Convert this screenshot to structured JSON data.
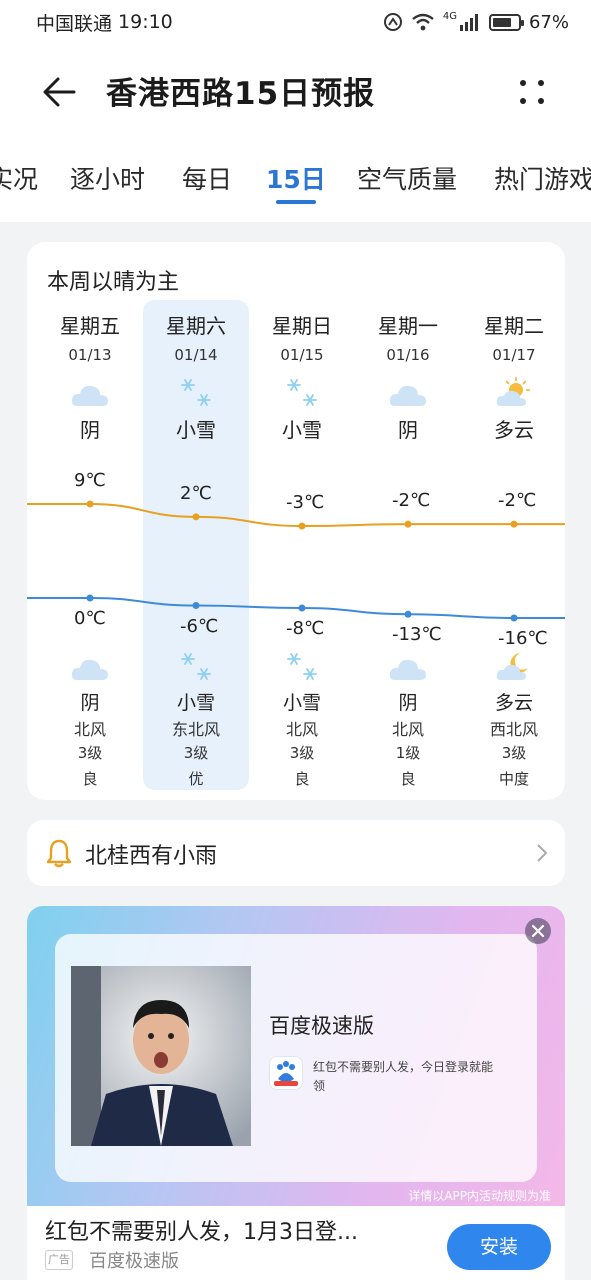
{
  "status_bar": {
    "carrier": "中国联通",
    "time": "19:10",
    "network": "4G",
    "battery": "67%"
  },
  "header": {
    "title": "香港西路15日预报",
    "back_icon": "arrow-left-icon",
    "more_icon": "more-dots-icon"
  },
  "tabs": [
    {
      "label": "实况"
    },
    {
      "label": "逐小时"
    },
    {
      "label": "每日"
    },
    {
      "label": "15日",
      "active": true
    },
    {
      "label": "空气质量"
    },
    {
      "label": "热门游戏"
    }
  ],
  "forecast": {
    "title": "本周以晴为主",
    "days": [
      {
        "day": "星期五",
        "date": "01/13",
        "day_weather": "阴",
        "day_icon": "cloud-icon",
        "high": "9℃",
        "low": "0℃",
        "night_icon": "cloud-icon",
        "night_weather": "阴",
        "wind_dir": "北风",
        "wind_level": "3级",
        "air": "良"
      },
      {
        "day": "星期六",
        "date": "01/14",
        "day_weather": "小雪",
        "day_icon": "snow-icon",
        "high": "2℃",
        "low": "-6℃",
        "night_icon": "snow-icon",
        "night_weather": "小雪",
        "wind_dir": "东北风",
        "wind_level": "3级",
        "air": "优"
      },
      {
        "day": "星期日",
        "date": "01/15",
        "day_weather": "小雪",
        "day_icon": "snow-icon",
        "high": "-3℃",
        "low": "-8℃",
        "night_icon": "snow-icon",
        "night_weather": "小雪",
        "wind_dir": "北风",
        "wind_level": "3级",
        "air": "良"
      },
      {
        "day": "星期一",
        "date": "01/16",
        "day_weather": "阴",
        "day_icon": "cloud-icon",
        "high": "-2℃",
        "low": "-13℃",
        "night_icon": "cloud-icon",
        "night_weather": "阴",
        "wind_dir": "北风",
        "wind_level": "1级",
        "air": "良"
      },
      {
        "day": "星期二",
        "date": "01/17",
        "day_weather": "多云",
        "day_icon": "sun-cloud-icon",
        "high": "-2℃",
        "low": "-16℃",
        "night_icon": "moon-cloud-icon",
        "night_weather": "多云",
        "wind_dir": "西北风",
        "wind_level": "3级",
        "air": "中度"
      }
    ],
    "selected_index": 1,
    "high_values": [
      9,
      2,
      -3,
      -2,
      -2
    ],
    "low_values": [
      0,
      -6,
      -8,
      -13,
      -16
    ],
    "high_color": "#e8a020",
    "low_color": "#3d8ad8"
  },
  "alert": {
    "icon": "bell-icon",
    "text": "北桂西有小雨"
  },
  "ad": {
    "app_name": "百度极速版",
    "description": "红包不需要别人发，今日登录就能领",
    "rules": "详情以APP内活动规则为准",
    "headline": "红包不需要别人发，1月3日登...",
    "tag": "广告",
    "brand": "百度极速版",
    "install": "安装",
    "accent": "#2f86ec"
  }
}
